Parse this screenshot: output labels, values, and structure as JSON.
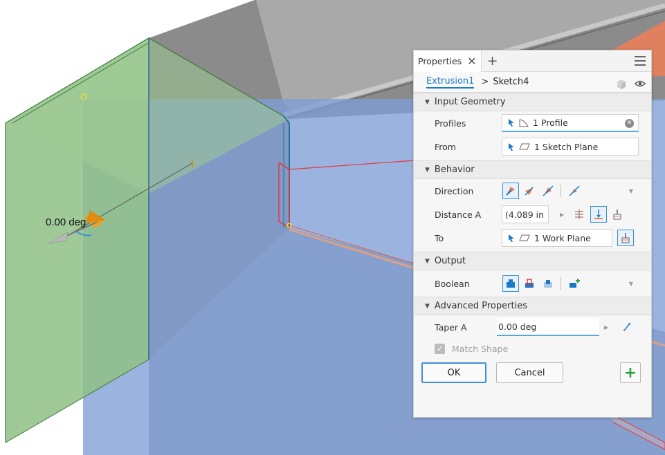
{
  "viewport": {
    "angle_readout": "0.00 deg"
  },
  "panel": {
    "tab_label": "Properties",
    "breadcrumb": {
      "link": "Extrusion1",
      "separator": ">",
      "current": "Sketch4"
    },
    "sections": {
      "input_geometry": {
        "title": "Input Geometry",
        "profiles_label": "Profiles",
        "profiles_value": "1 Profile",
        "from_label": "From",
        "from_value": "1 Sketch Plane"
      },
      "behavior": {
        "title": "Behavior",
        "direction_label": "Direction",
        "distance_label": "Distance A",
        "distance_value": "(4.089 in",
        "to_label": "To",
        "to_value": "1 Work Plane"
      },
      "output": {
        "title": "Output",
        "boolean_label": "Boolean"
      },
      "advanced": {
        "title": "Advanced Properties",
        "taper_label": "Taper A",
        "taper_value": "0.00 deg",
        "match_shape_label": "Match Shape",
        "match_shape_checked": true
      }
    },
    "buttons": {
      "ok": "OK",
      "cancel": "Cancel",
      "plus": "+"
    }
  },
  "colors": {
    "accent": "#1b7ac7",
    "sketch_plane": "#7f9fd6",
    "green_face": "#8fbf86",
    "orange_face": "#e8805a",
    "add_green": "#2f9e3e"
  },
  "icons": [
    "close-icon",
    "plus-icon",
    "menu-icon",
    "cursor-arrow-icon",
    "profile-icon",
    "plane-icon",
    "eye-icon",
    "cube-icon",
    "clear-icon"
  ]
}
